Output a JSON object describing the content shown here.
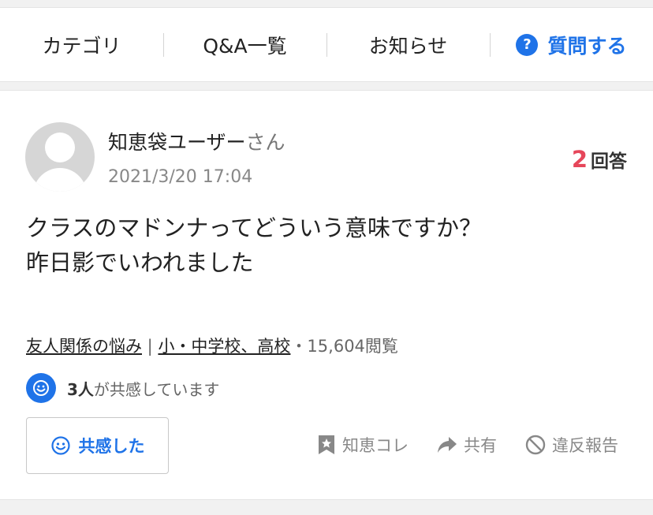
{
  "nav": {
    "items": [
      {
        "label": "カテゴリ"
      },
      {
        "label": "Q&A一覧"
      },
      {
        "label": "お知らせ"
      }
    ],
    "ask": {
      "icon_text": "?",
      "label": "質問する"
    }
  },
  "question": {
    "user": {
      "name": "知恵袋ユーザー",
      "suffix": "さん"
    },
    "datetime": "2021/3/20 17:04",
    "answers": {
      "count": "2",
      "label": "回答"
    },
    "lines": [
      "クラスのマドンナってどういう意味ですか？",
      "昨日影でいわれました"
    ],
    "meta": {
      "category1": "友人関係の悩み",
      "separator": " | ",
      "category2": "小・中学校、高校",
      "views": "・15,604閲覧"
    },
    "empathy": {
      "count": "3人",
      "text": "が共感しています"
    },
    "empathize_button": "共感した",
    "actions": {
      "chiecolle": "知恵コレ",
      "share": "共有",
      "report": "違反報告"
    }
  },
  "colors": {
    "accent": "#1f73e8",
    "answer_count": "#e6465a"
  }
}
